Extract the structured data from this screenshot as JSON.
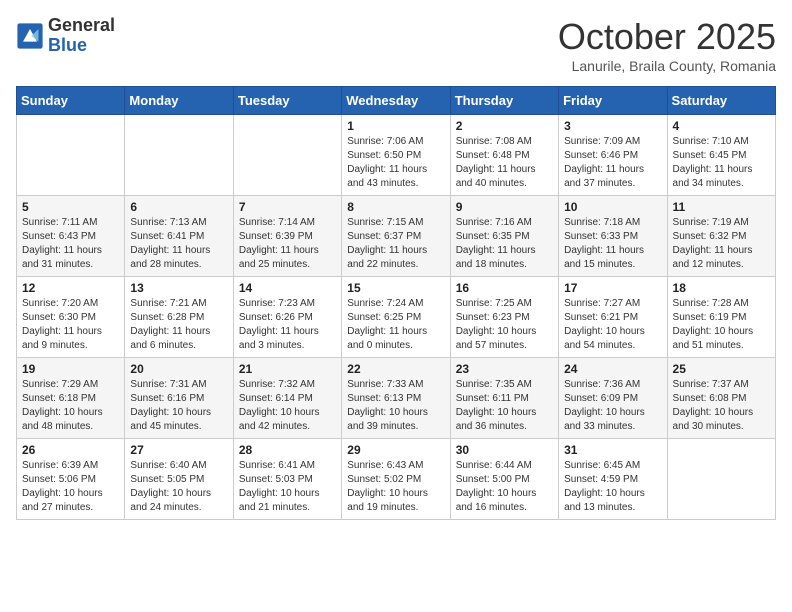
{
  "header": {
    "logo": {
      "general": "General",
      "blue": "Blue"
    },
    "title": "October 2025",
    "location": "Lanurile, Braila County, Romania"
  },
  "weekdays": [
    "Sunday",
    "Monday",
    "Tuesday",
    "Wednesday",
    "Thursday",
    "Friday",
    "Saturday"
  ],
  "weeks": [
    [
      {
        "day": "",
        "info": ""
      },
      {
        "day": "",
        "info": ""
      },
      {
        "day": "",
        "info": ""
      },
      {
        "day": "1",
        "info": "Sunrise: 7:06 AM\nSunset: 6:50 PM\nDaylight: 11 hours\nand 43 minutes."
      },
      {
        "day": "2",
        "info": "Sunrise: 7:08 AM\nSunset: 6:48 PM\nDaylight: 11 hours\nand 40 minutes."
      },
      {
        "day": "3",
        "info": "Sunrise: 7:09 AM\nSunset: 6:46 PM\nDaylight: 11 hours\nand 37 minutes."
      },
      {
        "day": "4",
        "info": "Sunrise: 7:10 AM\nSunset: 6:45 PM\nDaylight: 11 hours\nand 34 minutes."
      }
    ],
    [
      {
        "day": "5",
        "info": "Sunrise: 7:11 AM\nSunset: 6:43 PM\nDaylight: 11 hours\nand 31 minutes."
      },
      {
        "day": "6",
        "info": "Sunrise: 7:13 AM\nSunset: 6:41 PM\nDaylight: 11 hours\nand 28 minutes."
      },
      {
        "day": "7",
        "info": "Sunrise: 7:14 AM\nSunset: 6:39 PM\nDaylight: 11 hours\nand 25 minutes."
      },
      {
        "day": "8",
        "info": "Sunrise: 7:15 AM\nSunset: 6:37 PM\nDaylight: 11 hours\nand 22 minutes."
      },
      {
        "day": "9",
        "info": "Sunrise: 7:16 AM\nSunset: 6:35 PM\nDaylight: 11 hours\nand 18 minutes."
      },
      {
        "day": "10",
        "info": "Sunrise: 7:18 AM\nSunset: 6:33 PM\nDaylight: 11 hours\nand 15 minutes."
      },
      {
        "day": "11",
        "info": "Sunrise: 7:19 AM\nSunset: 6:32 PM\nDaylight: 11 hours\nand 12 minutes."
      }
    ],
    [
      {
        "day": "12",
        "info": "Sunrise: 7:20 AM\nSunset: 6:30 PM\nDaylight: 11 hours\nand 9 minutes."
      },
      {
        "day": "13",
        "info": "Sunrise: 7:21 AM\nSunset: 6:28 PM\nDaylight: 11 hours\nand 6 minutes."
      },
      {
        "day": "14",
        "info": "Sunrise: 7:23 AM\nSunset: 6:26 PM\nDaylight: 11 hours\nand 3 minutes."
      },
      {
        "day": "15",
        "info": "Sunrise: 7:24 AM\nSunset: 6:25 PM\nDaylight: 11 hours\nand 0 minutes."
      },
      {
        "day": "16",
        "info": "Sunrise: 7:25 AM\nSunset: 6:23 PM\nDaylight: 10 hours\nand 57 minutes."
      },
      {
        "day": "17",
        "info": "Sunrise: 7:27 AM\nSunset: 6:21 PM\nDaylight: 10 hours\nand 54 minutes."
      },
      {
        "day": "18",
        "info": "Sunrise: 7:28 AM\nSunset: 6:19 PM\nDaylight: 10 hours\nand 51 minutes."
      }
    ],
    [
      {
        "day": "19",
        "info": "Sunrise: 7:29 AM\nSunset: 6:18 PM\nDaylight: 10 hours\nand 48 minutes."
      },
      {
        "day": "20",
        "info": "Sunrise: 7:31 AM\nSunset: 6:16 PM\nDaylight: 10 hours\nand 45 minutes."
      },
      {
        "day": "21",
        "info": "Sunrise: 7:32 AM\nSunset: 6:14 PM\nDaylight: 10 hours\nand 42 minutes."
      },
      {
        "day": "22",
        "info": "Sunrise: 7:33 AM\nSunset: 6:13 PM\nDaylight: 10 hours\nand 39 minutes."
      },
      {
        "day": "23",
        "info": "Sunrise: 7:35 AM\nSunset: 6:11 PM\nDaylight: 10 hours\nand 36 minutes."
      },
      {
        "day": "24",
        "info": "Sunrise: 7:36 AM\nSunset: 6:09 PM\nDaylight: 10 hours\nand 33 minutes."
      },
      {
        "day": "25",
        "info": "Sunrise: 7:37 AM\nSunset: 6:08 PM\nDaylight: 10 hours\nand 30 minutes."
      }
    ],
    [
      {
        "day": "26",
        "info": "Sunrise: 6:39 AM\nSunset: 5:06 PM\nDaylight: 10 hours\nand 27 minutes."
      },
      {
        "day": "27",
        "info": "Sunrise: 6:40 AM\nSunset: 5:05 PM\nDaylight: 10 hours\nand 24 minutes."
      },
      {
        "day": "28",
        "info": "Sunrise: 6:41 AM\nSunset: 5:03 PM\nDaylight: 10 hours\nand 21 minutes."
      },
      {
        "day": "29",
        "info": "Sunrise: 6:43 AM\nSunset: 5:02 PM\nDaylight: 10 hours\nand 19 minutes."
      },
      {
        "day": "30",
        "info": "Sunrise: 6:44 AM\nSunset: 5:00 PM\nDaylight: 10 hours\nand 16 minutes."
      },
      {
        "day": "31",
        "info": "Sunrise: 6:45 AM\nSunset: 4:59 PM\nDaylight: 10 hours\nand 13 minutes."
      },
      {
        "day": "",
        "info": ""
      }
    ]
  ]
}
